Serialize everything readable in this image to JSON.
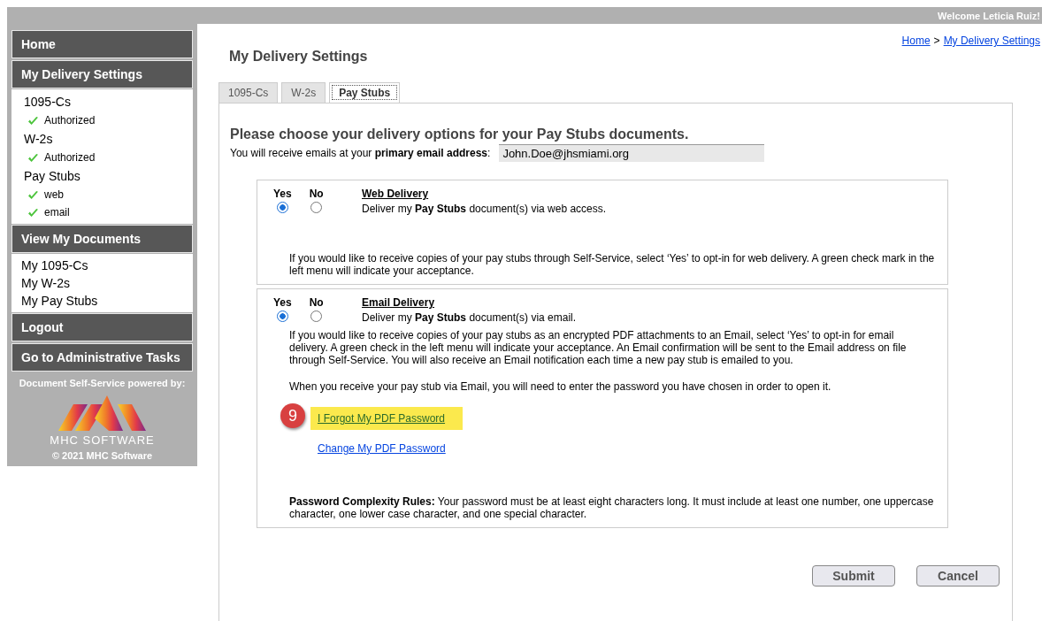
{
  "top_bar": {
    "welcome": "Welcome Leticia Ruiz!"
  },
  "sidebar": {
    "items": [
      {
        "kind": "header",
        "label": "Home"
      },
      {
        "kind": "header",
        "label": "My Delivery Settings"
      },
      {
        "kind": "group",
        "children": [
          {
            "kind": "category",
            "label": "1095-Cs"
          },
          {
            "kind": "status",
            "label": "Authorized",
            "checked": true
          },
          {
            "kind": "category",
            "label": "W-2s"
          },
          {
            "kind": "status",
            "label": "Authorized",
            "checked": true
          },
          {
            "kind": "category",
            "label": "Pay Stubs"
          },
          {
            "kind": "status",
            "label": "web",
            "checked": true
          },
          {
            "kind": "status",
            "label": "email",
            "checked": true
          }
        ]
      },
      {
        "kind": "header",
        "label": "View My Documents"
      },
      {
        "kind": "group",
        "children": [
          {
            "kind": "link",
            "label": "My 1095-Cs"
          },
          {
            "kind": "link",
            "label": "My W-2s"
          },
          {
            "kind": "link",
            "label": "My Pay Stubs"
          }
        ]
      },
      {
        "kind": "header",
        "label": "Logout"
      },
      {
        "kind": "header",
        "label": "Go to Administrative Tasks"
      }
    ],
    "powered_by": "Document Self-Service powered by:",
    "logo_text": "MHC SOFTWARE",
    "copyright": "© 2021  MHC Software"
  },
  "breadcrumb": [
    "Home",
    "My Delivery Settings"
  ],
  "breadcrumb_separator": ">",
  "page_title": "My Delivery Settings",
  "tabs": [
    {
      "label": "1095-Cs",
      "selected": false
    },
    {
      "label": "W-2s",
      "selected": false
    },
    {
      "label": "Pay Stubs",
      "selected": true
    }
  ],
  "heading": "Please choose your delivery options for your Pay Stubs documents.",
  "email_label": "You will receive emails at your **primary email address**:",
  "email_value": "John.Doe@jhsmiami.org",
  "sections": [
    {
      "title": "Web Delivery",
      "options": [
        {
          "label": "Yes",
          "selected": true
        },
        {
          "label": "No",
          "selected": false
        }
      ],
      "description": "Deliver my **Pay Stubs** document(s) via web access.",
      "paragraphs": [
        "If you would like to receive copies of your pay stubs through Self-Service, select ‘Yes’ to opt-in for web delivery. A green check mark in the left menu will indicate your acceptance."
      ]
    },
    {
      "title": "Email Delivery",
      "options": [
        {
          "label": "Yes",
          "selected": true
        },
        {
          "label": "No",
          "selected": false
        }
      ],
      "description": "Deliver my **Pay Stubs** document(s) via email.",
      "paragraphs": [
        "If you would like to receive copies of your pay stubs as an encrypted PDF attachments to an Email, select ‘Yes’ to opt-in for email delivery. A green check in the left menu will indicate your acceptance. An Email confirmation will be sent to the Email address on file through Self-Service. You will also receive an Email notification each time a new pay stub is emailed to you.",
        "When you receive your pay stub via Email, you will need to enter the password you have chosen in order to open it."
      ],
      "links": [
        {
          "label": "I Forgot My PDF Password",
          "highlighted": true,
          "badge": "9"
        },
        {
          "label": "Change My PDF Password",
          "highlighted": false
        }
      ],
      "rules": "**Password Complexity Rules:** Your password must be at least eight characters long. It must include at least one number, one uppercase character, one lower case character, and one special character."
    }
  ],
  "buttons": [
    "Submit",
    "Cancel"
  ]
}
